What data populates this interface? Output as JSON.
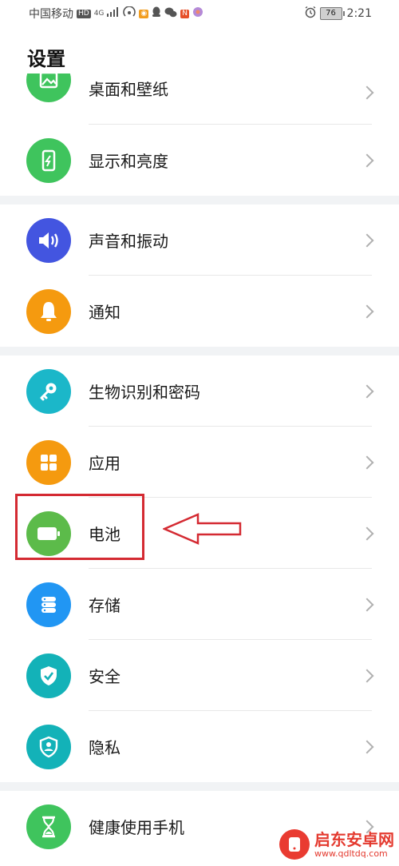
{
  "status_bar": {
    "carrier": "中国移动",
    "hd_badge": "HD",
    "network": "4G",
    "battery_level": "76",
    "time": "2:21"
  },
  "page_title": "设置",
  "items": [
    {
      "label": "桌面和壁纸",
      "icon": "wallpaper-icon",
      "color": "#3fc45d"
    },
    {
      "label": "显示和亮度",
      "icon": "display-brightness-icon",
      "color": "#3fc45d"
    },
    {
      "label": "声音和振动",
      "icon": "speaker-icon",
      "color": "#4355e0"
    },
    {
      "label": "通知",
      "icon": "bell-icon",
      "color": "#f59a0f"
    },
    {
      "label": "生物识别和密码",
      "icon": "key-icon",
      "color": "#1bb7c9"
    },
    {
      "label": "应用",
      "icon": "apps-grid-icon",
      "color": "#f59a0f"
    },
    {
      "label": "电池",
      "icon": "battery-icon",
      "color": "#5cbb4a"
    },
    {
      "label": "存储",
      "icon": "storage-icon",
      "color": "#2196f3"
    },
    {
      "label": "安全",
      "icon": "shield-check-icon",
      "color": "#13b2b8"
    },
    {
      "label": "隐私",
      "icon": "privacy-shield-icon",
      "color": "#13b2b8"
    },
    {
      "label": "健康使用手机",
      "icon": "hourglass-icon",
      "color": "#3fc45d"
    }
  ],
  "annotation": {
    "box_color": "#d42a32",
    "arrow_color": "#d42a32"
  },
  "watermark": {
    "title": "启东安卓网",
    "url": "www.qdltdq.com"
  }
}
